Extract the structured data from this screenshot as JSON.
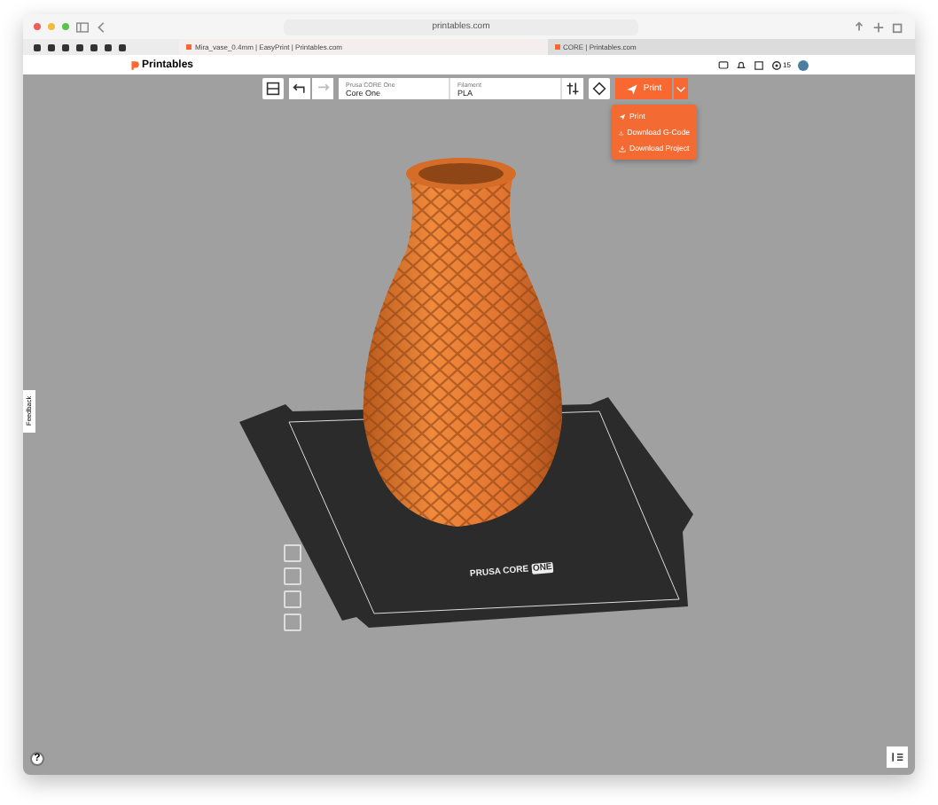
{
  "browser": {
    "address": "printables.com",
    "tabs": [
      {
        "title": "Mira_vase_0.4mm | EasyPrint | Printables.com",
        "selected": true
      },
      {
        "title": "CORE | Printables.com",
        "selected": false
      }
    ]
  },
  "site_header": {
    "logo": "Printables",
    "notification_count": "15"
  },
  "toolbar": {
    "printer_label": "Prusa CORE One",
    "printer": "Core One",
    "filament_label": "Filament",
    "filament": "PLA",
    "print_button": "Print"
  },
  "print_menu": {
    "open": true,
    "items": [
      {
        "label": "Print",
        "kind": "print"
      },
      {
        "label": "Download G-Code",
        "kind": "download"
      },
      {
        "label": "Download Project",
        "kind": "download"
      }
    ]
  },
  "feedback_tab": "Feedback",
  "help_button": "?",
  "bed_label": {
    "brand": "PRUSA CORE",
    "model": "ONE"
  }
}
